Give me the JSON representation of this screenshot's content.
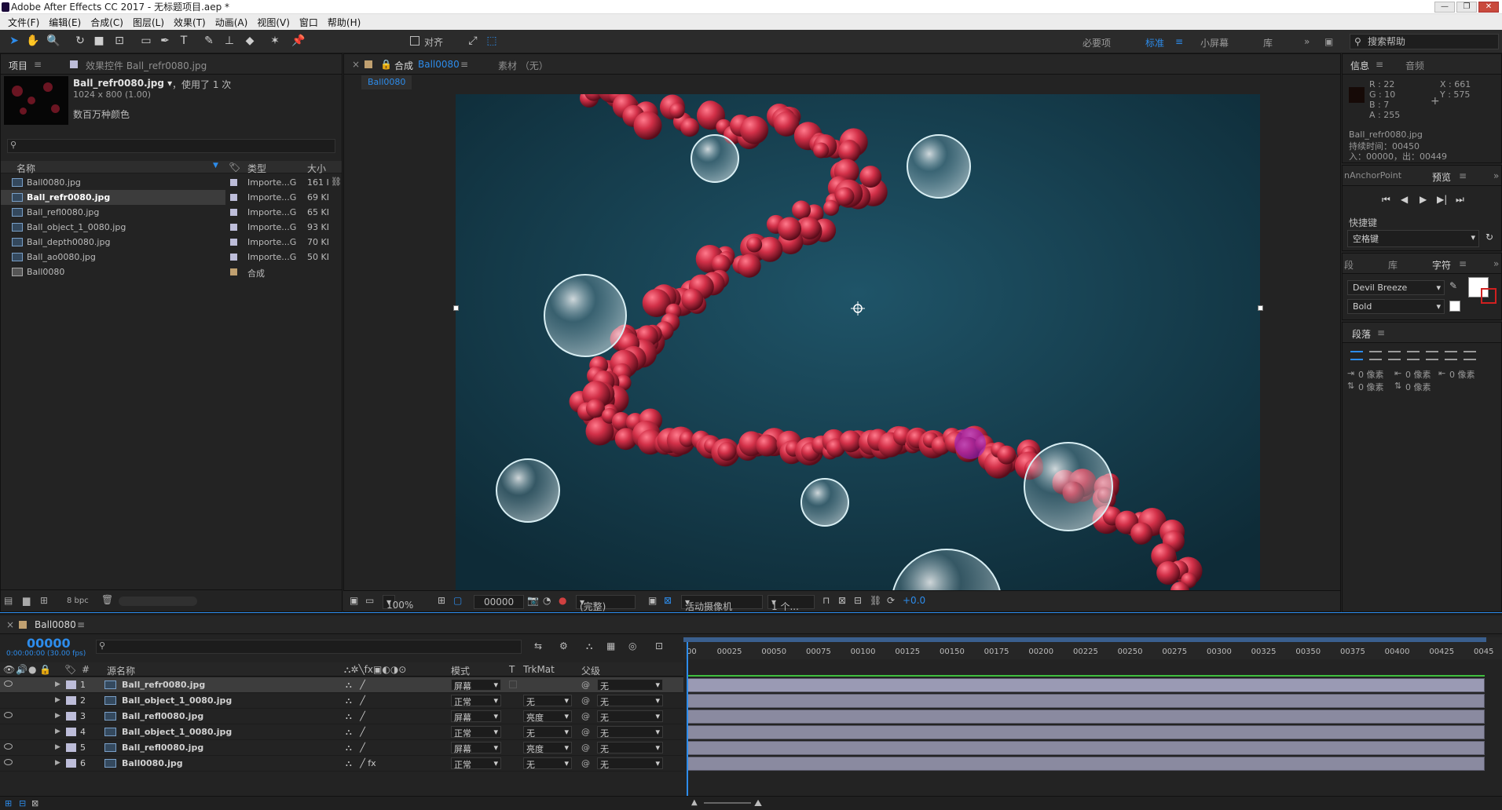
{
  "window": {
    "title": "Adobe After Effects CC 2017 - 无标题项目.aep *",
    "controls": [
      "—",
      "❐",
      "✕"
    ]
  },
  "menu": [
    "文件(F)",
    "编辑(E)",
    "合成(C)",
    "图层(L)",
    "效果(T)",
    "动画(A)",
    "视图(V)",
    "窗口",
    "帮助(H)"
  ],
  "toolbar": {
    "snap_label": "对齐",
    "workspaces": [
      "必要项",
      "标准",
      "小屏幕",
      "库"
    ],
    "active_workspace": "标准",
    "search_help": "搜索帮助"
  },
  "project": {
    "tabs": [
      "项目",
      "效果控件 Ball_refr0080.jpg"
    ],
    "selected_name": "Ball_refr0080.jpg ▾",
    "used": "，使用了 1 次",
    "dimensions": "1024 x 800 (1.00)",
    "color_depth": "数百万种颜色",
    "columns": {
      "name": "名称",
      "type": "类型",
      "size": "大小"
    },
    "items": [
      {
        "name": "Ball0080.jpg",
        "type": "Importe...G",
        "size": "161 I",
        "kind": "file"
      },
      {
        "name": "Ball_refr0080.jpg",
        "type": "Importe...G",
        "size": "69 KI",
        "kind": "file"
      },
      {
        "name": "Ball_refl0080.jpg",
        "type": "Importe...G",
        "size": "65 KI",
        "kind": "file"
      },
      {
        "name": "Ball_object_1_0080.jpg",
        "type": "Importe...G",
        "size": "93 KI",
        "kind": "file"
      },
      {
        "name": "Ball_depth0080.jpg",
        "type": "Importe...G",
        "size": "70 KI",
        "kind": "file"
      },
      {
        "name": "Ball_ao0080.jpg",
        "type": "Importe...G",
        "size": "50 KI",
        "kind": "file"
      },
      {
        "name": "Ball0080",
        "type": "合成",
        "size": "",
        "kind": "comp"
      }
    ],
    "bpc": "8 bpc"
  },
  "composition": {
    "tab_prefix": "合成",
    "tab_name": "Ball0080",
    "footage_tab": "素材 （无）",
    "sub_tab": "Ball0080",
    "zoom": "100%",
    "timecode": "00000",
    "resolution": "(完整)",
    "camera": "活动摄像机",
    "views": "1 个...",
    "exposure": "+0.0"
  },
  "info": {
    "tabs": [
      "信息",
      "音频"
    ],
    "r": "R : 22",
    "g": "G : 10",
    "b": "B : 7",
    "a": "A : 255",
    "x": "X : 661",
    "y": "Y : 575",
    "file": "Ball_refr0080.jpg",
    "duration": "持续时间：00450",
    "in_out": "入：00000，出：00449"
  },
  "preview": {
    "left_tab": "nAnchorPoint",
    "tab": "预览",
    "shortcut_label": "快捷键",
    "shortcut_value": "空格键"
  },
  "character": {
    "tabs": [
      "段",
      "库",
      "字符"
    ],
    "font": "Devil Breeze",
    "style": "Bold"
  },
  "paragraph": {
    "title": "段落",
    "indents": [
      "0 像素",
      "0 像素",
      "0 像素",
      "0 像素",
      "0 像素"
    ]
  },
  "timeline": {
    "comp_tab": "Ball0080",
    "timecode": "00000",
    "fps": "0:00:00:00 (30.00 fps)",
    "columns": {
      "num": "#",
      "name": "源名称",
      "mode": "模式",
      "t": "T",
      "trkmat": "TrkMat",
      "parent": "父级"
    },
    "ruler": [
      "00",
      "00025",
      "00050",
      "00075",
      "00100",
      "00125",
      "00150",
      "00175",
      "00200",
      "00225",
      "00250",
      "00275",
      "00300",
      "00325",
      "00350",
      "00375",
      "00400",
      "00425",
      "0045"
    ],
    "layers": [
      {
        "num": "1",
        "name": "Ball_refr0080.jpg",
        "mode": "屏幕",
        "trkmat": "",
        "parent": "无",
        "visible": true
      },
      {
        "num": "2",
        "name": "Ball_object_1_0080.jpg",
        "mode": "正常",
        "trkmat": "无",
        "parent": "无",
        "visible": false
      },
      {
        "num": "3",
        "name": "Ball_refl0080.jpg",
        "mode": "屏幕",
        "trkmat": "亮度",
        "parent": "无",
        "visible": true
      },
      {
        "num": "4",
        "name": "Ball_object_1_0080.jpg",
        "mode": "正常",
        "trkmat": "无",
        "parent": "无",
        "visible": false
      },
      {
        "num": "5",
        "name": "Ball_refl0080.jpg",
        "mode": "屏幕",
        "trkmat": "亮度",
        "parent": "无",
        "visible": true
      },
      {
        "num": "6",
        "name": "Ball0080.jpg",
        "mode": "正常",
        "trkmat": "无",
        "parent": "无",
        "visible": true
      }
    ]
  },
  "colors": {
    "accent": "#2d8ceb",
    "panel_bg": "#232323",
    "viewer_bg": "#173d4d",
    "ball_red": "#c8283f"
  }
}
